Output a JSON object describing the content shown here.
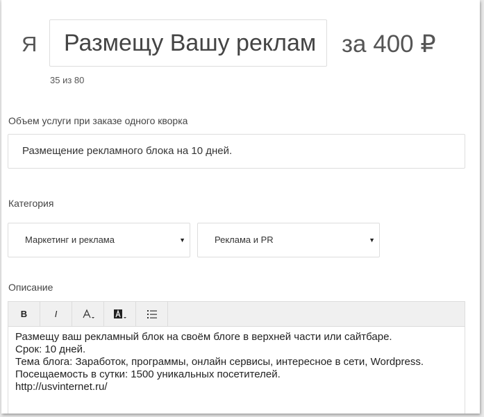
{
  "title": {
    "prefix": "Я",
    "value": "Размещу Вашу реклам",
    "suffix": "за 400 ₽",
    "counter": "35 из 80"
  },
  "volume": {
    "label": "Объем услуги при заказе одного кворка",
    "value": "Размещение рекламного блока на 10 дней."
  },
  "category": {
    "label": "Категория",
    "primary": "Маркетинг и реклама",
    "secondary": "Реклама и PR",
    "caret": "▼"
  },
  "description": {
    "label": "Описание",
    "toolbar": {
      "bold": "B",
      "italic": "I"
    },
    "lines": [
      "Размещу ваш рекламный блок на своём блоге в верхней части или сайтбаре.",
      "Срок: 10 дней.",
      "Тема блога: Заработок, программы, онлайн сервисы, интересное в сети, Wordpress.",
      "Посещаемость в сутки: 1500 уникальных посетителей.",
      "http://usvinternet.ru/"
    ]
  },
  "icons": {
    "font_color": "font-color-icon",
    "background_color": "background-color-icon",
    "list": "ordered-list-icon"
  }
}
